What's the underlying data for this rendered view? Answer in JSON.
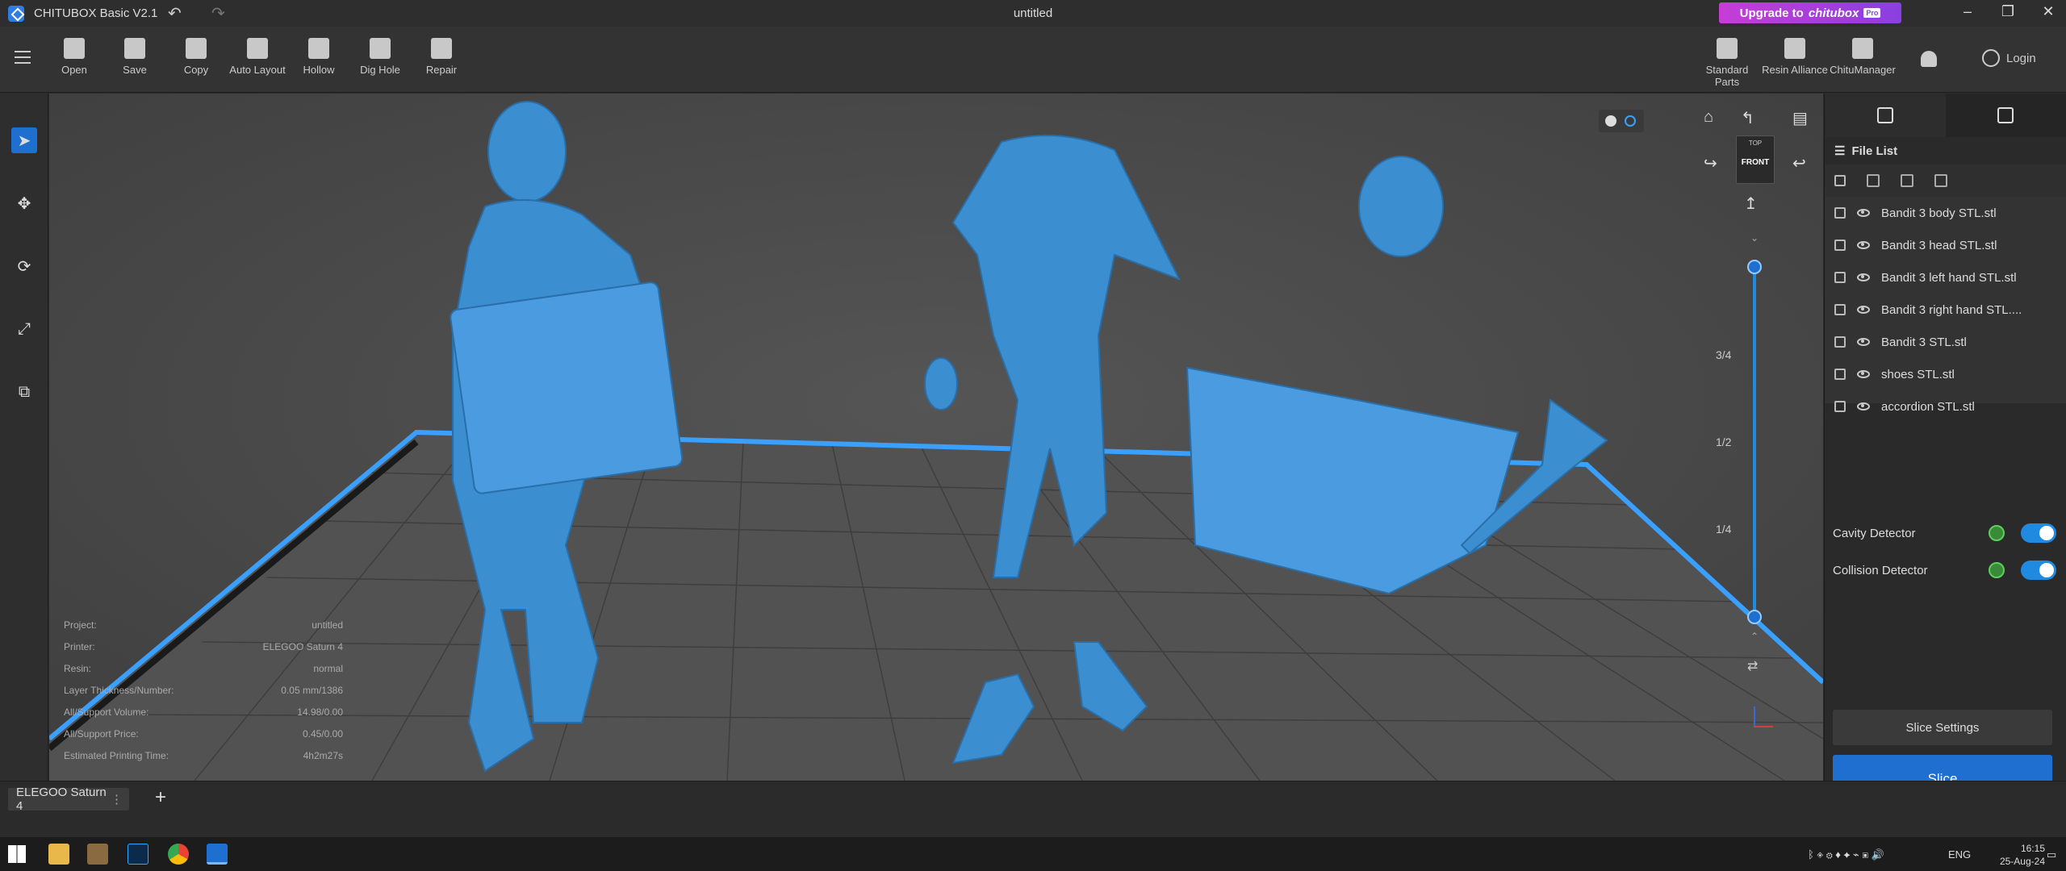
{
  "window": {
    "app_title": "CHITUBOX Basic V2.1",
    "doc_title": "untitled",
    "upgrade_label": "Upgrade to",
    "upgrade_brand": "chitubox",
    "upgrade_badge": "Pro"
  },
  "toolbar": {
    "items": [
      {
        "label": "Open",
        "icon": "folder-icon"
      },
      {
        "label": "Save",
        "icon": "save-icon"
      },
      {
        "label": "Copy",
        "icon": "copy-icon"
      },
      {
        "label": "Auto Layout",
        "icon": "auto-layout-icon"
      },
      {
        "label": "Hollow",
        "icon": "hollow-icon"
      },
      {
        "label": "Dig Hole",
        "icon": "dig-hole-icon"
      },
      {
        "label": "Repair",
        "icon": "repair-icon"
      }
    ],
    "right_items": [
      {
        "label": "Standard Parts",
        "icon": "standard-parts-icon"
      },
      {
        "label": "Resin Alliance",
        "icon": "resin-alliance-icon"
      },
      {
        "label": "ChituManager",
        "icon": "chitumanager-icon"
      }
    ],
    "login": "Login"
  },
  "left_tools": [
    "select-icon",
    "move-icon",
    "rotate-icon",
    "scale-icon",
    "mirror-icon"
  ],
  "viewport": {
    "cube_top": "TOP",
    "cube_front": "FRONT",
    "slider_marks": [
      "3/4",
      "1/2",
      "1/4"
    ]
  },
  "info": {
    "rows": [
      {
        "label": "Project:",
        "value": "untitled"
      },
      {
        "label": "Printer:",
        "value": "ELEGOO Saturn 4"
      },
      {
        "label": "Resin:",
        "value": "normal"
      },
      {
        "label": "Layer Thickness/Number:",
        "value": "0.05 mm/1386"
      },
      {
        "label": "All/Support Volume:",
        "value": "14.98/0.00"
      },
      {
        "label": "All/Support Price:",
        "value": "0.45/0.00"
      },
      {
        "label": "Estimated Printing Time:",
        "value": "4h2m27s"
      }
    ]
  },
  "file_list": {
    "title": "File List",
    "files": [
      "Bandit 3 body STL.stl",
      "Bandit 3 head STL.stl",
      "Bandit 3 left hand STL.stl",
      "Bandit 3 right hand STL....",
      "Bandit 3 STL.stl",
      "shoes STL.stl",
      "accordion STL.stl"
    ]
  },
  "detectors": [
    {
      "label": "Cavity Detector",
      "enabled": true
    },
    {
      "label": "Collision Detector",
      "enabled": true
    }
  ],
  "buttons": {
    "slice_settings": "Slice Settings",
    "slice": "Slice"
  },
  "bottom": {
    "printer_tab": "ELEGOO Saturn 4"
  },
  "taskbar": {
    "lang": "ENG",
    "time": "16:15",
    "date": "25-Aug-24"
  },
  "colors": {
    "accent": "#1f6fd1",
    "model": "#3b8fd0",
    "plate_edge": "#3aa0ff",
    "upgrade": "#c63dd6"
  }
}
